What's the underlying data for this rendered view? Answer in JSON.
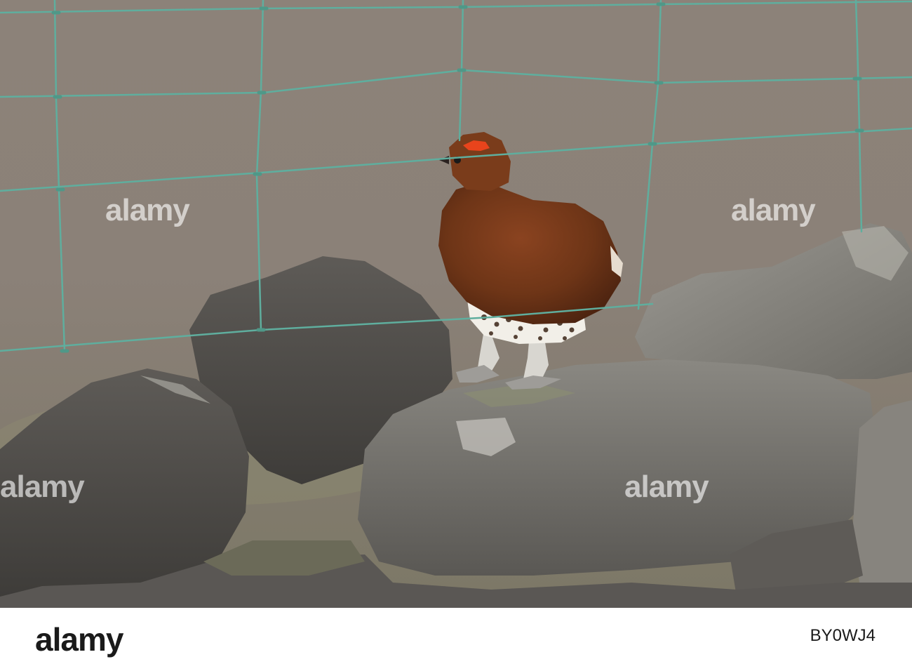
{
  "watermark": {
    "text": "alamy"
  },
  "footer": {
    "logo": "alamy",
    "image_ref": "BY0WJ4"
  },
  "colors": {
    "background_moor": "#8a8178",
    "fence_wire": "#5fae9e",
    "grouse_body": "#6e3517",
    "eye_comb": "#e8441c",
    "stone": "#6f6c68"
  }
}
